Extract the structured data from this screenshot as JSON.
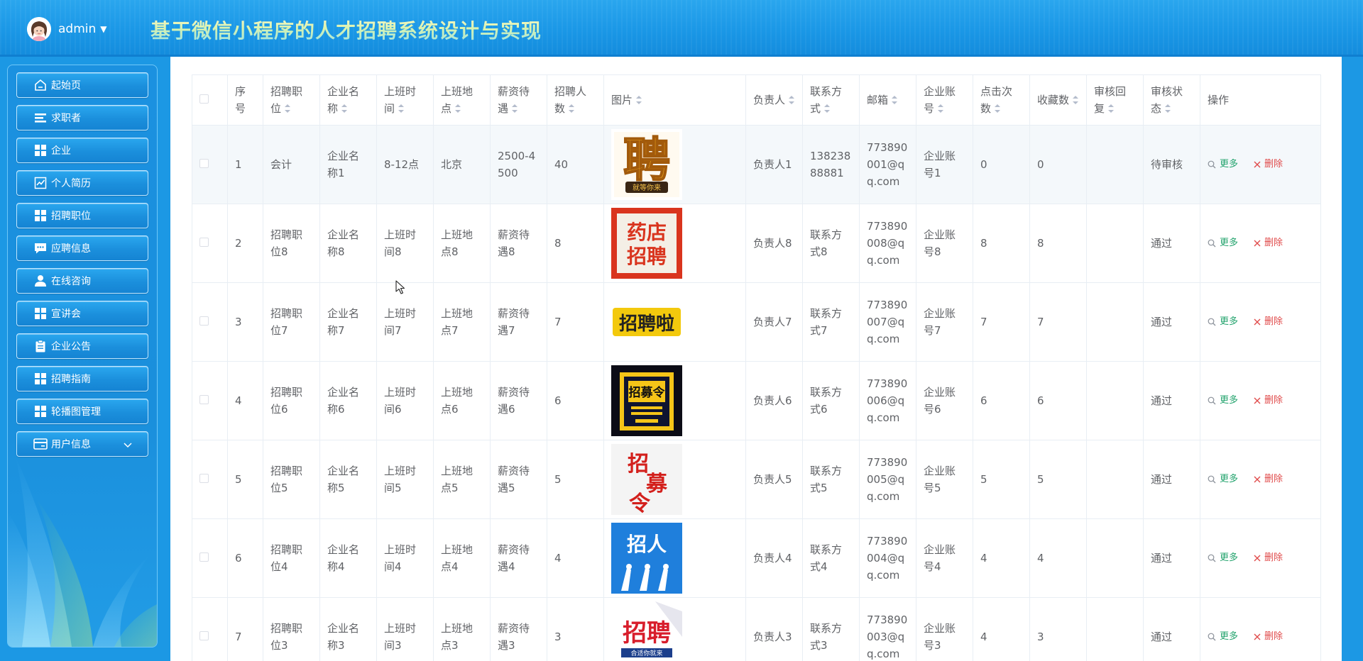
{
  "header": {
    "username": "admin",
    "title": "基于微信小程序的人才招聘系统设计与实现"
  },
  "sidebar": {
    "items": [
      {
        "label": "起始页",
        "icon": "home-icon"
      },
      {
        "label": "求职者",
        "icon": "list-icon"
      },
      {
        "label": "企业",
        "icon": "grid-icon"
      },
      {
        "label": "个人简历",
        "icon": "chart-icon"
      },
      {
        "label": "招聘职位",
        "icon": "grid-icon"
      },
      {
        "label": "应聘信息",
        "icon": "chat-icon"
      },
      {
        "label": "在线咨询",
        "icon": "user-icon"
      },
      {
        "label": "宣讲会",
        "icon": "grid-icon"
      },
      {
        "label": "企业公告",
        "icon": "clipboard-icon"
      },
      {
        "label": "招聘指南",
        "icon": "grid-icon"
      },
      {
        "label": "轮播图管理",
        "icon": "grid-icon"
      },
      {
        "label": "用户信息",
        "icon": "card-icon"
      }
    ]
  },
  "table": {
    "columns": [
      "序号",
      "招聘职位",
      "企业名称",
      "上班时间",
      "上班地点",
      "薪资待遇",
      "招聘人数",
      "图片",
      "负责人",
      "联系方式",
      "邮箱",
      "企业账号",
      "点击次数",
      "收藏数",
      "审核回复",
      "审核状态",
      "操作"
    ],
    "more_label": "更多",
    "delete_label": "删除",
    "rows": [
      {
        "no": "1",
        "position": "会计",
        "company": "企业名称1",
        "time": "8-12点",
        "place": "北京",
        "salary": "2500-4500",
        "count": "40",
        "image": "poster-pin-gold",
        "manager": "负责人1",
        "contact": "13823888881",
        "email": "773890001@qq.com",
        "account": "企业账号1",
        "clicks": "0",
        "favorites": "0",
        "reply": "",
        "status": "待审核"
      },
      {
        "no": "2",
        "position": "招聘职位8",
        "company": "企业名称8",
        "time": "上班时间8",
        "place": "上班地点8",
        "salary": "薪资待遇8",
        "count": "8",
        "image": "poster-pharmacy",
        "manager": "负责人8",
        "contact": "联系方式8",
        "email": "773890008@qq.com",
        "account": "企业账号8",
        "clicks": "8",
        "favorites": "8",
        "reply": "",
        "status": "通过"
      },
      {
        "no": "3",
        "position": "招聘职位7",
        "company": "企业名称7",
        "time": "上班时间7",
        "place": "上班地点7",
        "salary": "薪资待遇7",
        "count": "7",
        "image": "poster-recruit-yellow",
        "manager": "负责人7",
        "contact": "联系方式7",
        "email": "773890007@qq.com",
        "account": "企业账号7",
        "clicks": "7",
        "favorites": "7",
        "reply": "",
        "status": "通过"
      },
      {
        "no": "4",
        "position": "招聘职位6",
        "company": "企业名称6",
        "time": "上班时间6",
        "place": "上班地点6",
        "salary": "薪资待遇6",
        "count": "6",
        "image": "poster-zhaomuling-dark",
        "manager": "负责人6",
        "contact": "联系方式6",
        "email": "773890006@qq.com",
        "account": "企业账号6",
        "clicks": "6",
        "favorites": "6",
        "reply": "",
        "status": "通过"
      },
      {
        "no": "5",
        "position": "招聘职位5",
        "company": "企业名称5",
        "time": "上班时间5",
        "place": "上班地点5",
        "salary": "薪资待遇5",
        "count": "5",
        "image": "poster-zhaomuling-red",
        "manager": "负责人5",
        "contact": "联系方式5",
        "email": "773890005@qq.com",
        "account": "企业账号5",
        "clicks": "5",
        "favorites": "5",
        "reply": "",
        "status": "通过"
      },
      {
        "no": "6",
        "position": "招聘职位4",
        "company": "企业名称4",
        "time": "上班时间4",
        "place": "上班地点4",
        "salary": "薪资待遇4",
        "count": "4",
        "image": "poster-zhaoren-blue",
        "manager": "负责人4",
        "contact": "联系方式4",
        "email": "773890004@qq.com",
        "account": "企业账号4",
        "clicks": "4",
        "favorites": "4",
        "reply": "",
        "status": "通过"
      },
      {
        "no": "7",
        "position": "招聘职位3",
        "company": "企业名称3",
        "time": "上班时间3",
        "place": "上班地点3",
        "salary": "薪资待遇3",
        "count": "3",
        "image": "poster-zhaopin-red",
        "manager": "负责人3",
        "contact": "联系方式3",
        "email": "773890003@qq.com",
        "account": "企业账号3",
        "clicks": "4",
        "favorites": "3",
        "reply": "",
        "status": "通过"
      }
    ]
  },
  "posters": {
    "p1_text": "聘",
    "p1_sub": "就等你来",
    "p2_text": "药店招聘",
    "p3_text": "招聘啦",
    "p4_text": "招募令",
    "p5_text": "招募令",
    "p6_text": "招人",
    "p7_text": "招聘",
    "p7_sub": "合适你就来"
  },
  "colors": {
    "header_blue": "#1a97e6",
    "more_green": "#23a36d",
    "delete_red": "#e04b4b"
  }
}
